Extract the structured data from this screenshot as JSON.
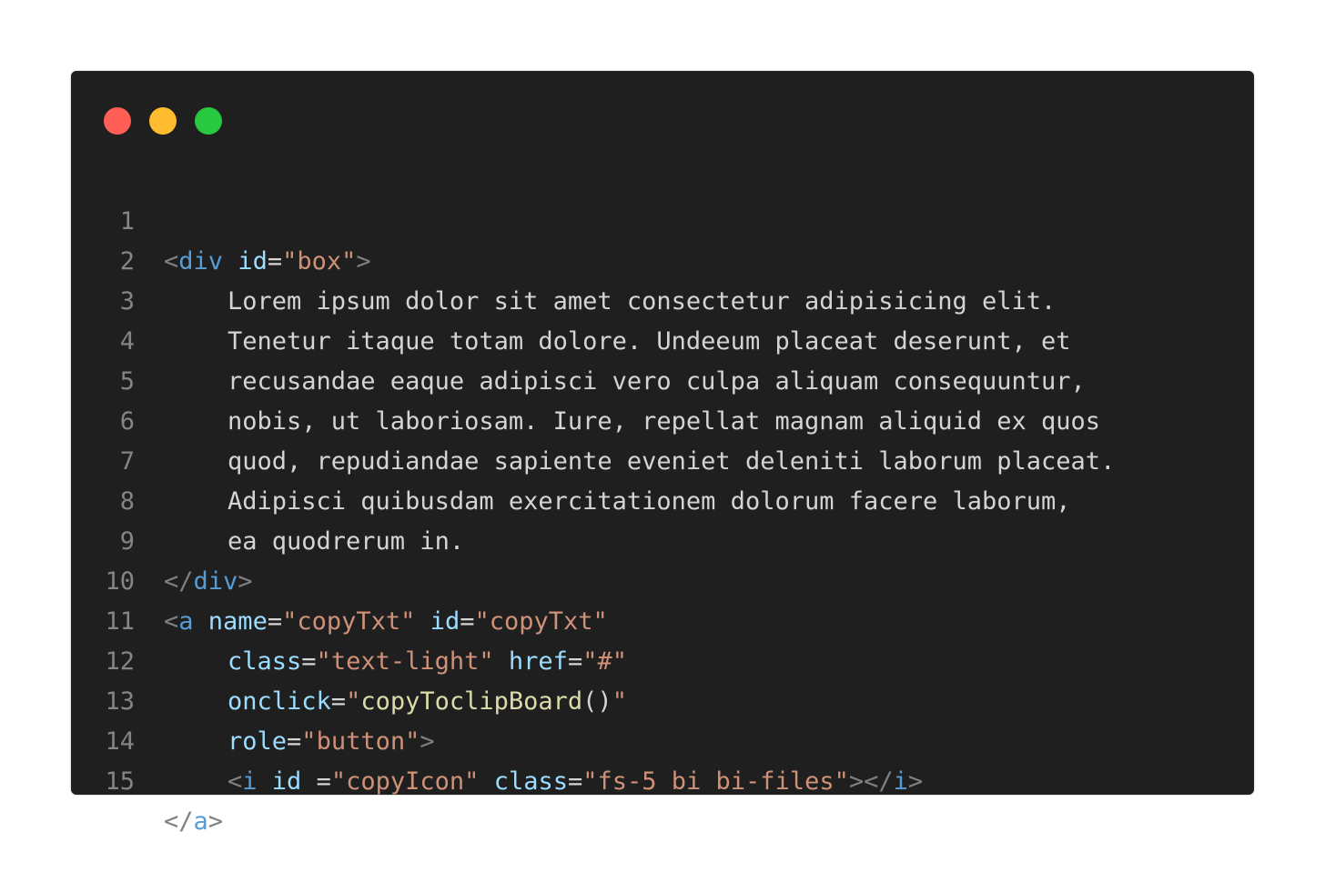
{
  "window": {
    "traffic_lights": [
      {
        "name": "close",
        "color": "#ff5f57"
      },
      {
        "name": "minimize",
        "color": "#febc2e"
      },
      {
        "name": "maximize",
        "color": "#28c840"
      }
    ]
  },
  "colors": {
    "background": "#1f1f1f",
    "tag_bracket": "#808080",
    "tag_name": "#569cd6",
    "attribute": "#9cdcfe",
    "string": "#ce9178",
    "text": "#d4d4d4",
    "function": "#dcdcaa",
    "line_number": "#858585"
  },
  "code": {
    "lines": [
      {
        "n": "1"
      },
      {
        "n": "2",
        "text": "Lorem ipsum dolor sit amet consectetur adipisicing elit."
      },
      {
        "n": "3",
        "text": "Tenetur itaque totam dolore. Undeeum placeat deserunt, et"
      },
      {
        "n": "4",
        "text": "recusandae eaque adipisci vero culpa aliquam consequuntur,"
      },
      {
        "n": "5",
        "text": "nobis, ut laboriosam. Iure, repellat magnam aliquid ex quos"
      },
      {
        "n": "6",
        "text": "quod, repudiandae sapiente eveniet deleniti laborum placeat."
      },
      {
        "n": "7",
        "text": "Adipisci quibusdam exercitationem dolorum facere laborum,"
      },
      {
        "n": "8",
        "text": "ea quodrerum in."
      },
      {
        "n": "9"
      },
      {
        "n": "10"
      },
      {
        "n": "11"
      },
      {
        "n": "12"
      },
      {
        "n": "13"
      },
      {
        "n": "14"
      },
      {
        "n": "15"
      }
    ],
    "tokens": {
      "lt": "<",
      "gt": ">",
      "close_lt": "</",
      "eq": "=",
      "q": "\"",
      "div": "div",
      "a": "a",
      "i": "i",
      "id": "id",
      "id_spaced": "id ",
      "name": "name",
      "class": "class",
      "href": "href",
      "onclick": "onclick",
      "role": "role",
      "box": "box",
      "copyTxt": "copyTxt",
      "text_light": "text-light",
      "hash": "#",
      "fn_name": "copyToclipBoard",
      "parens": "()",
      "button": "button",
      "copyIcon": "copyIcon",
      "icon_classes": "fs-5 bi bi-files"
    }
  }
}
